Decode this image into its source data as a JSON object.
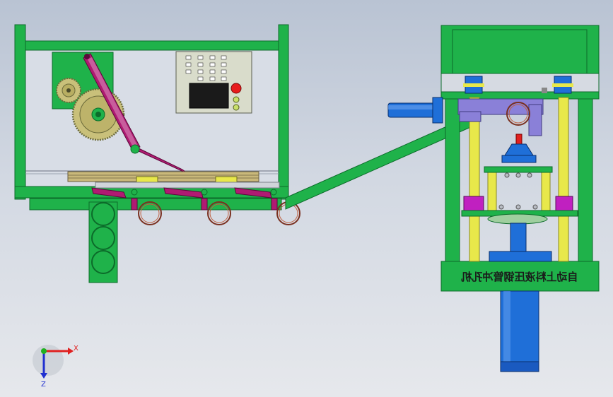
{
  "machine_label": "自动上料液压钢管冲孔机",
  "axes": {
    "x_label": "X",
    "z_label": "Z",
    "x_color": "#e02020",
    "y_color": "#20b020",
    "z_color": "#2030d0"
  },
  "colors": {
    "frame_green": "#1fb24a",
    "frame_dark": "#0c6b2a",
    "yellow": "#e8e84a",
    "magenta": "#b01a72",
    "blue": "#1f6fd8",
    "control_panel": "#d9dccb",
    "gear": "#c9c07a",
    "lavender": "#8a80d8",
    "purple_head": "#c020c0"
  },
  "control_panel": {
    "buttons_color": "#e81c1c",
    "indicator_colors": [
      "#c9e06a",
      "#c9e06a"
    ]
  }
}
